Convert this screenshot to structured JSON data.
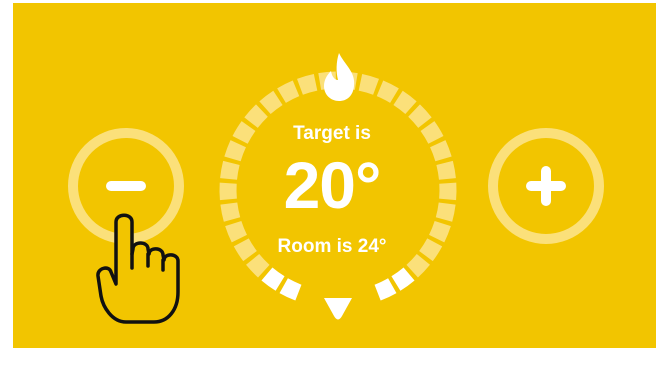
{
  "thermostat": {
    "target_label": "Target is",
    "target_value": "20°",
    "room_label": "Room is 24°",
    "target_temp": 20,
    "room_temp": 24,
    "mode_icon": "flame-icon",
    "decrease_icon": "minus-icon",
    "increase_icon": "plus-icon",
    "pointer_icon": "hand-pointer-icon"
  },
  "colors": {
    "background": "#f2c500",
    "ring_light": "#fbe07a",
    "active": "#ffffff",
    "text": "#ffffff",
    "hand_outline": "#111111"
  }
}
